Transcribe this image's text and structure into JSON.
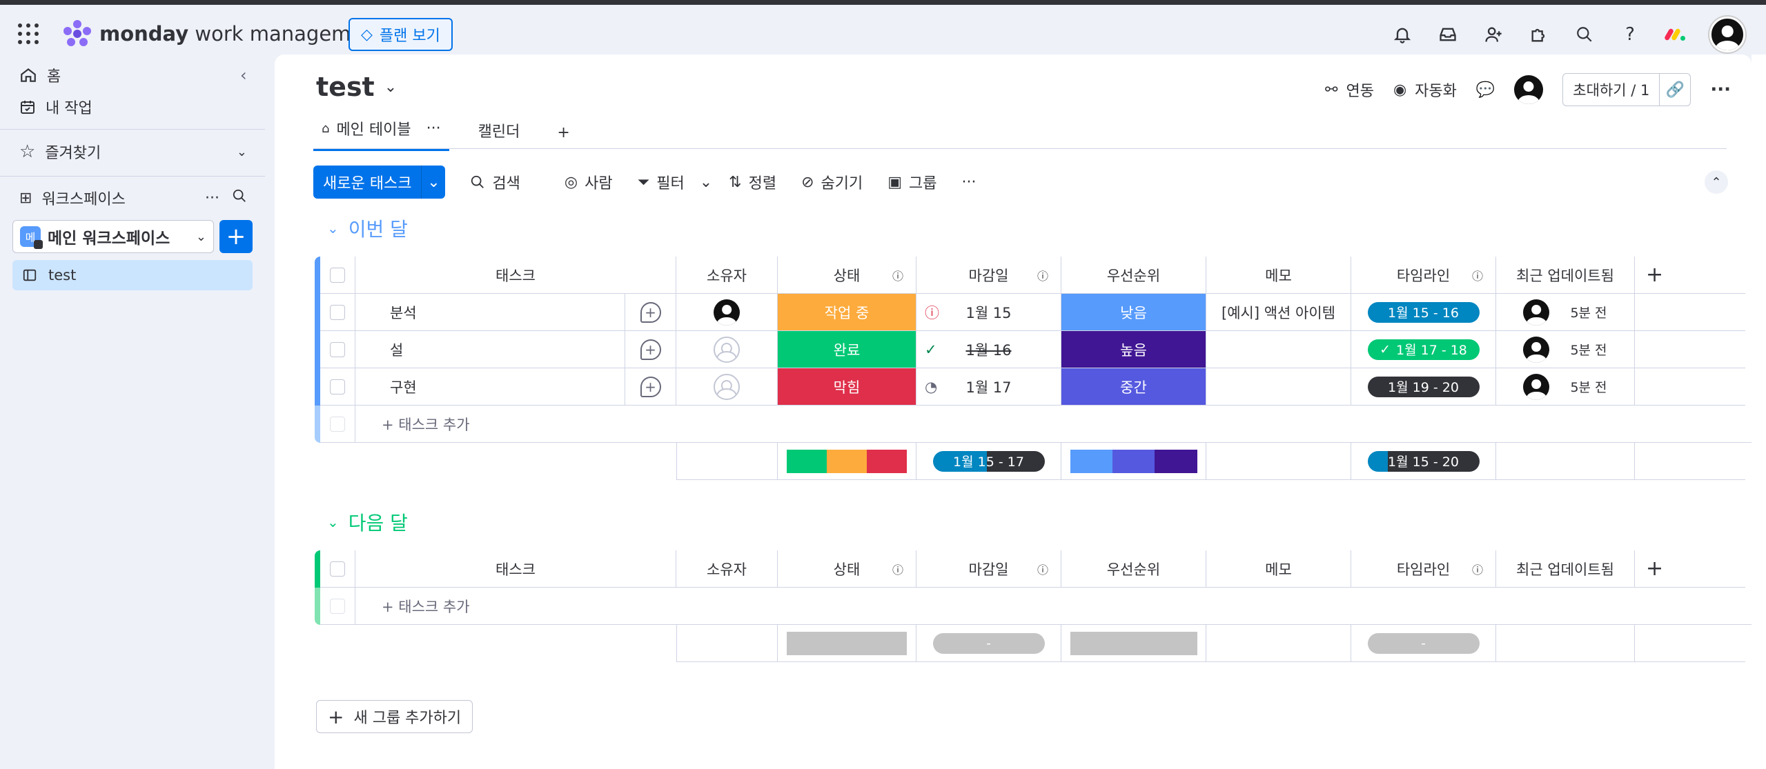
{
  "app": {
    "brand_bold": "monday",
    "brand_rest": " work management",
    "plan_button": "플랜 보기",
    "top_icons": [
      "bell-icon",
      "inbox-icon",
      "invite-user-icon",
      "apps-icon",
      "search-icon",
      "help-icon",
      "monday-logo-icon",
      "avatar"
    ]
  },
  "sidebar": {
    "home": "홈",
    "my_work": "내 작업",
    "favorites": "즐겨찾기",
    "workspaces": "워크스페이스",
    "ws_badge": "메",
    "ws_name": "메인 워크스페이스",
    "board": "test"
  },
  "board": {
    "title": "test",
    "integrate": "연동",
    "automate": "자동화",
    "invite": "초대하기 / 1",
    "tabs": [
      "메인 테이블",
      "캘린더"
    ]
  },
  "toolbar": {
    "new_task": "새로운 태스크",
    "search": "검색",
    "person": "사람",
    "filter": "필터",
    "sort": "정렬",
    "hide": "숨기기",
    "group": "그룹"
  },
  "columns": [
    "태스크",
    "소유자",
    "상태",
    "마감일",
    "우선순위",
    "메모",
    "타임라인",
    "최근 업데이트됨"
  ],
  "groups": [
    {
      "title": "이번 달",
      "color": "#579bfc",
      "rows": [
        {
          "task": "분석",
          "owner": "filled",
          "status": "작업 중",
          "status_color": "#fdab3d",
          "due_icon": "!",
          "due": "1월 15",
          "priority": "낮음",
          "priority_color": "#579bfc",
          "memo": "[예시] 액션 아이템",
          "timeline": "1월 15 - 16",
          "timeline_color": "#0086c0",
          "updated": "5분 전"
        },
        {
          "task": "설",
          "owner": "empty",
          "status": "완료",
          "status_color": "#00c875",
          "due_icon": "✓",
          "due": "1월 16",
          "priority": "높음",
          "priority_color": "#401694",
          "memo": "",
          "timeline": "1월 17 - 18",
          "timeline_color": "#00c875",
          "updated": "5분 전"
        },
        {
          "task": "구현",
          "owner": "empty",
          "status": "막힘",
          "status_color": "#df2f4a",
          "due_icon": "◔",
          "due": "1월 17",
          "priority": "중간",
          "priority_color": "#5559df",
          "memo": "",
          "timeline": "1월 19 - 20",
          "timeline_color": "#323338",
          "updated": "5분 전"
        }
      ],
      "add_task": "+ 태스크 추가",
      "summary_due": "1월 15 - 17",
      "summary_timeline": "1월 15 - 20"
    },
    {
      "title": "다음 달",
      "color": "#00c875",
      "rows": [],
      "add_task": "+ 태스크 추가",
      "summary_due": "-",
      "summary_timeline": "-"
    }
  ],
  "add_group": "새 그룹 추가하기"
}
